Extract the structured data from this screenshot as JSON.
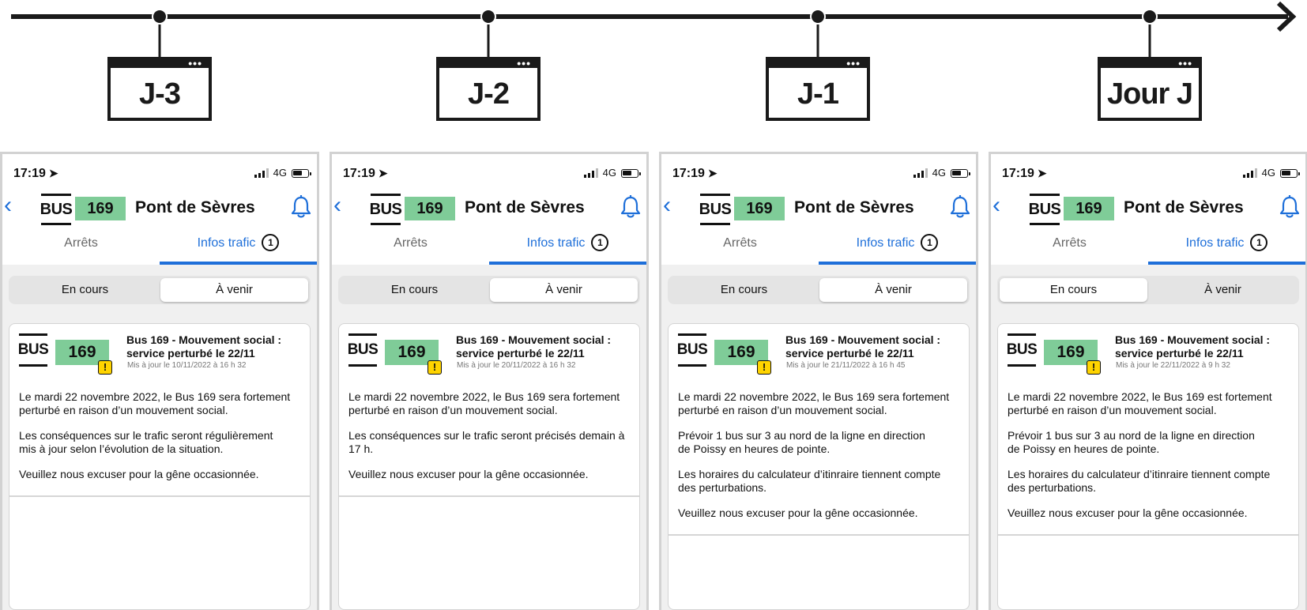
{
  "colors": {
    "accent": "#1e6fd9",
    "line_badge": "#7fcc98",
    "warning": "#ffd400",
    "timeline": "#1a1a1a"
  },
  "timeline": {
    "stages": [
      "J-3",
      "J-2",
      "J-1",
      "Jour J"
    ]
  },
  "phones": [
    {
      "status_time": "17:19",
      "network": "4G",
      "header": {
        "bus_mark": "BUS",
        "line_number": "169",
        "stop_name": "Pont de Sèvres"
      },
      "tabs": {
        "stops": "Arrêts",
        "traffic": "Infos trafic",
        "traffic_count": "1"
      },
      "segments": {
        "current": "En cours",
        "upcoming": "À venir",
        "selected": "upcoming"
      },
      "card": {
        "bus_mark": "BUS",
        "line_number": "169",
        "warning_symbol": "!",
        "title": "Bus 169 - Mouvement social : service perturbé le 22/11",
        "updated": "Mis à jour le 10/11/2022 à 16 h 32",
        "paragraphs": [
          "Le mardi 22 novembre 2022, le Bus 169 sera fortement\nperturbé en raison d’un mouvement social.",
          "Les conséquences sur le trafic seront régulièrement\nmis à jour selon l’évolution de la situation.",
          "Veuillez nous excuser pour la gêne occasionnée."
        ]
      }
    },
    {
      "status_time": "17:19",
      "network": "4G",
      "header": {
        "bus_mark": "BUS",
        "line_number": "169",
        "stop_name": "Pont de Sèvres"
      },
      "tabs": {
        "stops": "Arrêts",
        "traffic": "Infos trafic",
        "traffic_count": "1"
      },
      "segments": {
        "current": "En cours",
        "upcoming": "À venir",
        "selected": "upcoming"
      },
      "card": {
        "bus_mark": "BUS",
        "line_number": "169",
        "warning_symbol": "!",
        "title": "Bus 169 - Mouvement social : service perturbé le 22/11",
        "updated": "Mis à jour le 20/11/2022 à 16 h 32",
        "paragraphs": [
          "Le mardi 22 novembre 2022, le Bus 169 sera fortement\nperturbé en raison d’un mouvement social.",
          "Les conséquences sur le trafic seront précisés demain à 17 h.",
          "Veuillez nous excuser pour la gêne occasionnée."
        ]
      }
    },
    {
      "status_time": "17:19",
      "network": "4G",
      "header": {
        "bus_mark": "BUS",
        "line_number": "169",
        "stop_name": "Pont de Sèvres"
      },
      "tabs": {
        "stops": "Arrêts",
        "traffic": "Infos trafic",
        "traffic_count": "1"
      },
      "segments": {
        "current": "En cours",
        "upcoming": "À venir",
        "selected": "upcoming"
      },
      "card": {
        "bus_mark": "BUS",
        "line_number": "169",
        "warning_symbol": "!",
        "title": "Bus 169 - Mouvement social : service perturbé le 22/11",
        "updated": "Mis à jour le 21/11/2022 à 16 h 45",
        "paragraphs": [
          "Le mardi 22 novembre 2022, le Bus 169 sera fortement\nperturbé en raison d’un mouvement social.",
          "Prévoir 1 bus sur 3 au nord de la ligne en direction\nde Poissy en heures de pointe.",
          "Les horaires du calculateur d’itinraire tiennent compte\ndes perturbations.",
          "Veuillez nous excuser pour la gêne occasionnée."
        ]
      }
    },
    {
      "status_time": "17:19",
      "network": "4G",
      "header": {
        "bus_mark": "BUS",
        "line_number": "169",
        "stop_name": "Pont de Sèvres"
      },
      "tabs": {
        "stops": "Arrêts",
        "traffic": "Infos trafic",
        "traffic_count": "1"
      },
      "segments": {
        "current": "En cours",
        "upcoming": "À venir",
        "selected": "current"
      },
      "card": {
        "bus_mark": "BUS",
        "line_number": "169",
        "warning_symbol": "!",
        "title": "Bus 169 - Mouvement social : service perturbé le 22/11",
        "updated": "Mis à jour le 22/11/2022 à 9 h 32",
        "paragraphs": [
          "Le mardi 22 novembre 2022, le Bus 169 est fortement\nperturbé en raison d’un mouvement social.",
          "Prévoir 1 bus sur 3 au nord de la ligne en direction\nde Poissy en heures de pointe.",
          "Les horaires du calculateur d’itinraire tiennent compte\ndes perturbations.",
          "Veuillez nous excuser pour la gêne occasionnée."
        ]
      }
    }
  ]
}
